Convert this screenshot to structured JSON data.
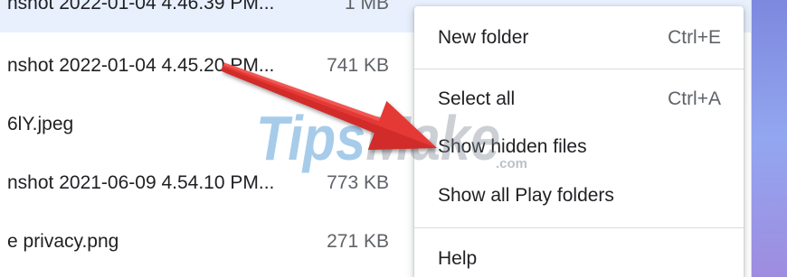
{
  "file_list": {
    "rows": [
      {
        "name": "nshot 2022-01-04 4.46.39 PM...",
        "size": "1 MB",
        "selected": true
      },
      {
        "name": "nshot 2022-01-04 4.45.20 PM...",
        "size": "741 KB",
        "selected": false
      },
      {
        "name": "6lY.jpeg",
        "selected": false
      },
      {
        "name": "nshot 2021-06-09 4.54.10 PM...",
        "size": "773 KB",
        "selected": false
      },
      {
        "name": "e privacy.png",
        "size": "271 KB",
        "selected": false
      }
    ]
  },
  "context_menu": {
    "items": [
      {
        "label": "New folder",
        "shortcut": "Ctrl+E"
      },
      {
        "label": "Select all",
        "shortcut": "Ctrl+A"
      },
      {
        "label": "Show hidden files"
      },
      {
        "label": "Show all Play folders"
      },
      {
        "label": "Help"
      }
    ]
  },
  "watermark": {
    "brand_first": "Tips",
    "brand_second": "Make",
    "domain": ".com"
  },
  "colors": {
    "selected_row": "#e8f0fe",
    "text_primary": "#202124",
    "text_secondary": "#5f6368",
    "divider": "#dadce0",
    "arrow_red": "#e53935",
    "arrow_dark": "#b71c1c",
    "wallpaper_top": "#7d88de",
    "wallpaper_mid": "#93a6f0",
    "wallpaper_bottom": "#9f8ce0",
    "watermark_blue": "#2e86cc",
    "watermark_gray": "#7a8590"
  }
}
